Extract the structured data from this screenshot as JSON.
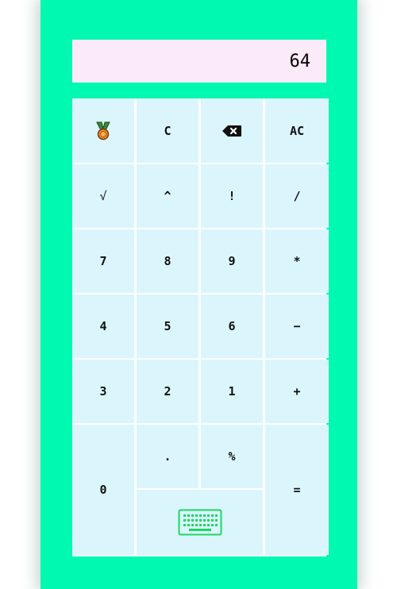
{
  "display": {
    "value": "64"
  },
  "keys": {
    "medal_icon": "medal-icon",
    "clear": "C",
    "backspace_icon": "backspace-icon",
    "all_clear": "AC",
    "sqrt": "√",
    "power": "^",
    "factorial": "!",
    "divide": "/",
    "seven": "7",
    "eight": "8",
    "nine": "9",
    "multiply": "*",
    "four": "4",
    "five": "5",
    "six": "6",
    "minus": "−",
    "three": "3",
    "two": "2",
    "one": "1",
    "plus": "+",
    "zero": "0",
    "dot": ".",
    "percent": "%",
    "keyboard_icon": "keyboard-icon",
    "equals": "="
  },
  "colors": {
    "frame": "#00f9b0",
    "display_bg": "#fbeaf8",
    "key_bg": "#daf6fc",
    "keyboard_icon": "#1dd663"
  }
}
